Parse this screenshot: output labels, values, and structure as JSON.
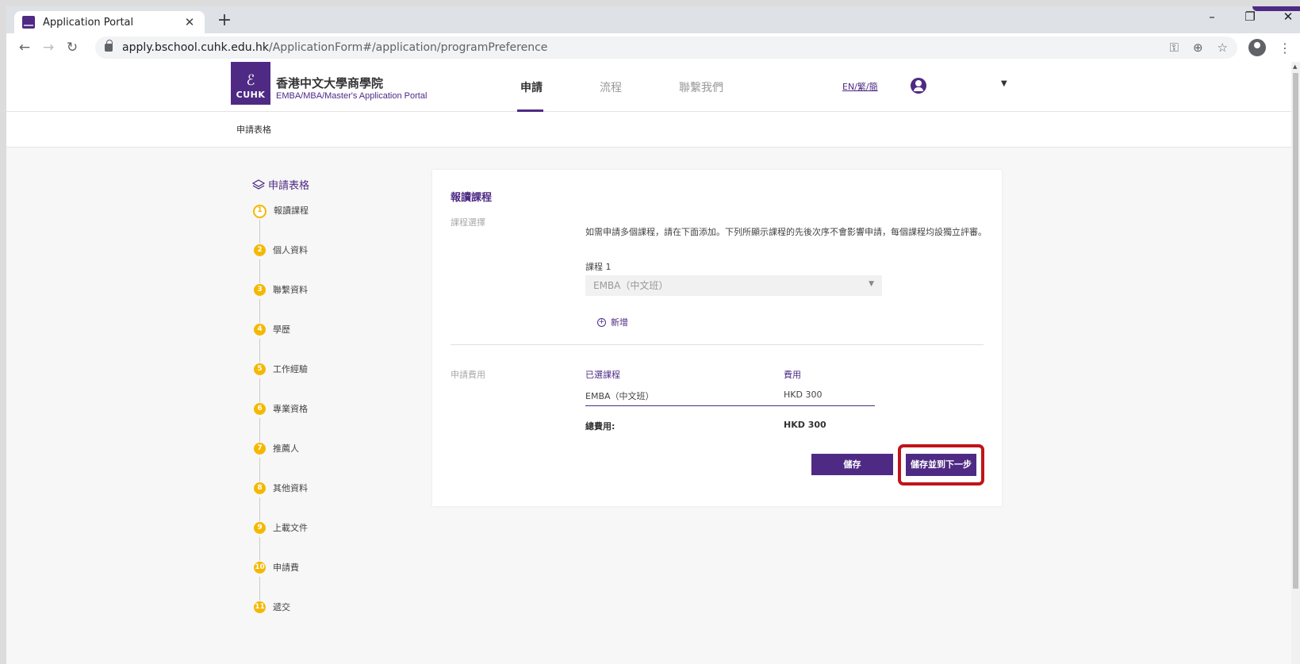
{
  "browser": {
    "tab_title": "Application Portal",
    "tab_close": "✕",
    "new_tab": "+",
    "url_domain": "apply.bschool.cuhk.edu.hk",
    "url_path": "/ApplicationForm#/application/programPreference",
    "window_controls": [
      "–",
      "❐",
      "✕"
    ]
  },
  "header": {
    "logo_text": "CUHK",
    "school_name": "香港中文大學商學院",
    "school_sub": "EMBA/MBA/Master's Application Portal",
    "nav": [
      "申請",
      "流程",
      "聯繫我們"
    ],
    "lang": "EN/繁/簡",
    "accent": "#4e2a84"
  },
  "breadcrumb": "申請表格",
  "stepper": {
    "title": "申請表格",
    "steps": [
      {
        "num": "1",
        "label": "報讀課程"
      },
      {
        "num": "2",
        "label": "個人資料"
      },
      {
        "num": "3",
        "label": "聯繫資料"
      },
      {
        "num": "4",
        "label": "學歷"
      },
      {
        "num": "5",
        "label": "工作經驗"
      },
      {
        "num": "6",
        "label": "專業資格"
      },
      {
        "num": "7",
        "label": "推薦人"
      },
      {
        "num": "8",
        "label": "其他資料"
      },
      {
        "num": "9",
        "label": "上載文件"
      },
      {
        "num": "10",
        "label": "申請費"
      },
      {
        "num": "11",
        "label": "遞交"
      }
    ],
    "step_color": "#f5b800"
  },
  "form": {
    "title": "報讀課程",
    "course_section_label": "課程選擇",
    "instruction": "如需申請多個課程，請在下面添加。下列所顯示課程的先後次序不會影響申請，每個課程均設獨立評審。",
    "course_label": "課程 1",
    "course_value": "EMBA（中文班）",
    "add_label": "新增",
    "fee_section_label": "申請費用",
    "fee_headers": {
      "course": "已選課程",
      "fee": "費用"
    },
    "fee_row": {
      "course": "EMBA（中文班）",
      "fee": "HKD 300"
    },
    "total_label": "總費用:",
    "total_value": "HKD 300",
    "save_label": "儲存",
    "save_next_label": "儲存並到下一步",
    "highlight_color": "#c0141a"
  }
}
